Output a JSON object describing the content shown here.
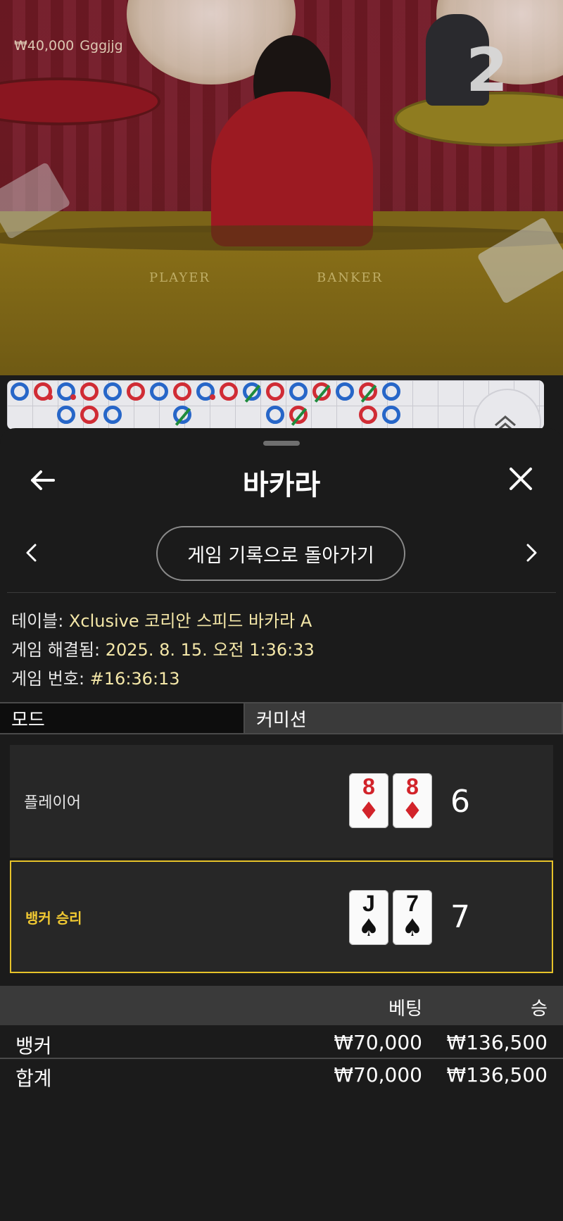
{
  "video": {
    "balance_amount": "₩40,000",
    "player_name": "Gggjjg",
    "countdown": "2",
    "felt_player": "PLAYER",
    "felt_banker": "BANKER"
  },
  "roadmap": {
    "top_row": [
      "blue",
      "red-dot",
      "blue-dot",
      "red",
      "blue",
      "red",
      "blue",
      "red",
      "blue-dot",
      "red",
      "blue-tie",
      "red",
      "blue",
      "red-tie",
      "blue",
      "red-tie",
      "blue"
    ],
    "bottom_row": [
      "",
      "",
      "blue",
      "red",
      "blue",
      "",
      "",
      "blue-tie",
      "",
      "",
      "",
      "blue",
      "red-tie",
      "",
      "",
      "red",
      "blue"
    ]
  },
  "header": {
    "title": "바카라",
    "back_icon": "arrow-left-icon",
    "close_icon": "close-icon"
  },
  "nav": {
    "history_button": "게임 기록으로 돌아가기"
  },
  "info": {
    "table_label": "테이블: ",
    "table_value": "Xclusive 코리안 스피드 바카라 A",
    "resolved_label": "게임 해결됨: ",
    "resolved_value": "2025. 8. 15. 오전 1:36:33",
    "round_label": "게임 번호: ",
    "round_value": "#16:36:13"
  },
  "tabs": {
    "mode": "모드",
    "commission": "커미션"
  },
  "hands": {
    "player": {
      "label": "플레이어",
      "cards": [
        {
          "rank": "8",
          "suit": "♦",
          "color": "red"
        },
        {
          "rank": "8",
          "suit": "♦",
          "color": "red"
        }
      ],
      "total": "6"
    },
    "banker": {
      "label": "뱅커 승리",
      "cards": [
        {
          "rank": "J",
          "suit": "♠",
          "color": "black"
        },
        {
          "rank": "7",
          "suit": "♠",
          "color": "black"
        }
      ],
      "total": "7"
    }
  },
  "bets": {
    "col_bet": "베팅",
    "col_win": "승",
    "rows": [
      {
        "name": "뱅커",
        "bet": "₩70,000",
        "win": "₩136,500"
      }
    ],
    "total": {
      "name": "합계",
      "bet": "₩70,000",
      "win": "₩136,500"
    }
  },
  "colors": {
    "accent_gold": "#e6c22a",
    "info_value": "#f4e7a8",
    "road_blue": "#2766c8",
    "road_red": "#d02c35",
    "road_tie": "#1e8a3c"
  }
}
